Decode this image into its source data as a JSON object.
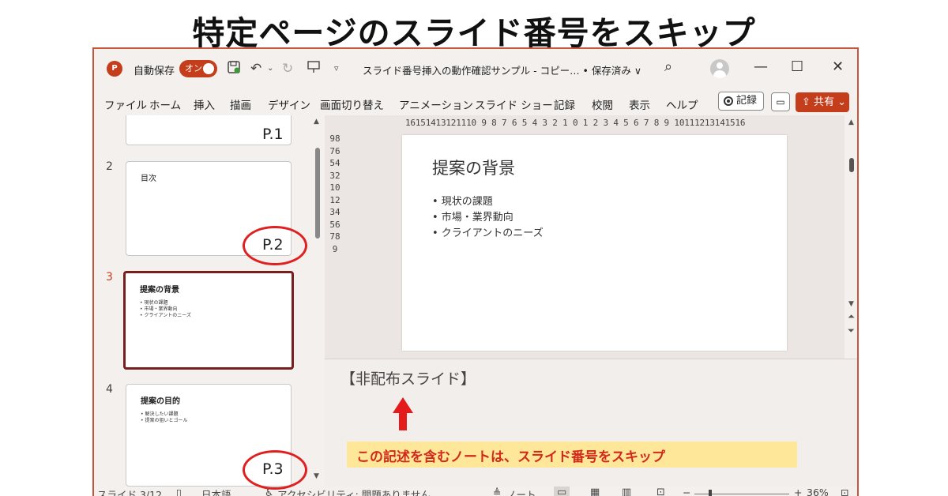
{
  "banner": {
    "title": "特定ページのスライド番号をスキップ"
  },
  "titlebar": {
    "app_icon": "P",
    "autosave_label": "自動保存",
    "autosave_toggle": "オン",
    "document_title": "スライド番号挿入の動作確認サンプル - コピー… • 保存済み ∨",
    "minimize": "—",
    "maximize": "☐",
    "close": "✕"
  },
  "menu": {
    "items": [
      "ファイル",
      "ホーム",
      "挿入",
      "描画",
      "デザイン",
      "画面切り替え",
      "アニメーション",
      "スライド ショー",
      "記録",
      "校閲",
      "表示",
      "ヘルプ"
    ],
    "record_button": "記録",
    "share_button": "共有 ⌄"
  },
  "thumbnails": {
    "slide1": {
      "page_label": "P.1"
    },
    "slide2": {
      "number": "2",
      "title": "目次",
      "page_label": "P.2"
    },
    "slide3": {
      "number": "3",
      "title": "提案の背景",
      "bullets": [
        "• 現状の課題",
        "• 市場・業界動向",
        "• クライアントのニーズ"
      ]
    },
    "slide4": {
      "number": "4",
      "title": "提案の目的",
      "bullets": [
        "• 解決したい課題",
        "• 提案の狙いとゴール"
      ],
      "page_label": "P.3"
    }
  },
  "editor": {
    "ruler_h": "16151413121110 9 8 7 6 5 4 3 2 1 0 1 2 3 4 5 6 7 8 9 10111213141516",
    "ruler_v": "9876543210123456789",
    "slide_title": "提案の背景",
    "bullets": [
      "• 現状の課題",
      "• 市場・業界動向",
      "• クライアントのニーズ"
    ]
  },
  "notes": {
    "text": "【非配布スライド】",
    "callout": "この記述を含むノートは、スライド番号をスキップ"
  },
  "statusbar": {
    "slide_counter": "スライド 3/12",
    "language": "日本語",
    "accessibility": "アクセシビリティ: 問題ありません",
    "notes_button": "ノート",
    "zoom": "36%"
  },
  "colors": {
    "accent": "#c43e1c",
    "highlight_circle": "#e02020",
    "callout_bg": "#ffe79a",
    "callout_text": "#d12a1a"
  }
}
